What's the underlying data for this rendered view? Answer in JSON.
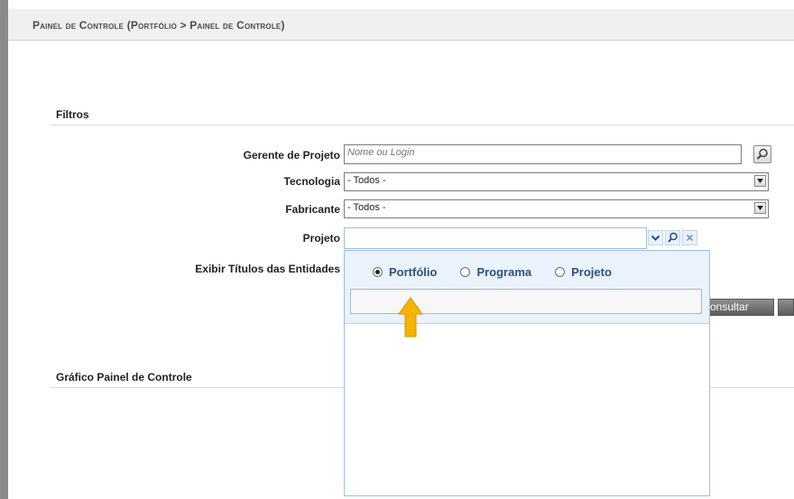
{
  "header": {
    "title": "Painel de Controle (Portfólio > Painel de Controle)"
  },
  "filters": {
    "title": "Filtros",
    "manager_label": "Gerente de Projeto",
    "manager_placeholder": "Nome ou Login",
    "technology_label": "Tecnologia",
    "technology_value": "- Todos -",
    "manufacturer_label": "Fabricante",
    "manufacturer_value": "- Todos -",
    "project_label": "Projeto",
    "project_value": "",
    "show_titles_label": "Exibir Títulos das Entidades"
  },
  "project_dropdown": {
    "options": [
      "Portfólio",
      "Programa",
      "Projeto"
    ],
    "selected": "Portfólio",
    "search_value": ""
  },
  "buttons": {
    "consult_label": "onsultar"
  },
  "chart_section": {
    "title": "Gráfico Painel de Controle"
  },
  "colors": {
    "accent": "#2f4f7f",
    "dropdown_bg": "#eaf2fc",
    "arrow": "#f5b400"
  },
  "icons": [
    "search-icon",
    "chevron-down-icon",
    "close-icon",
    "arrow-up-icon"
  ]
}
